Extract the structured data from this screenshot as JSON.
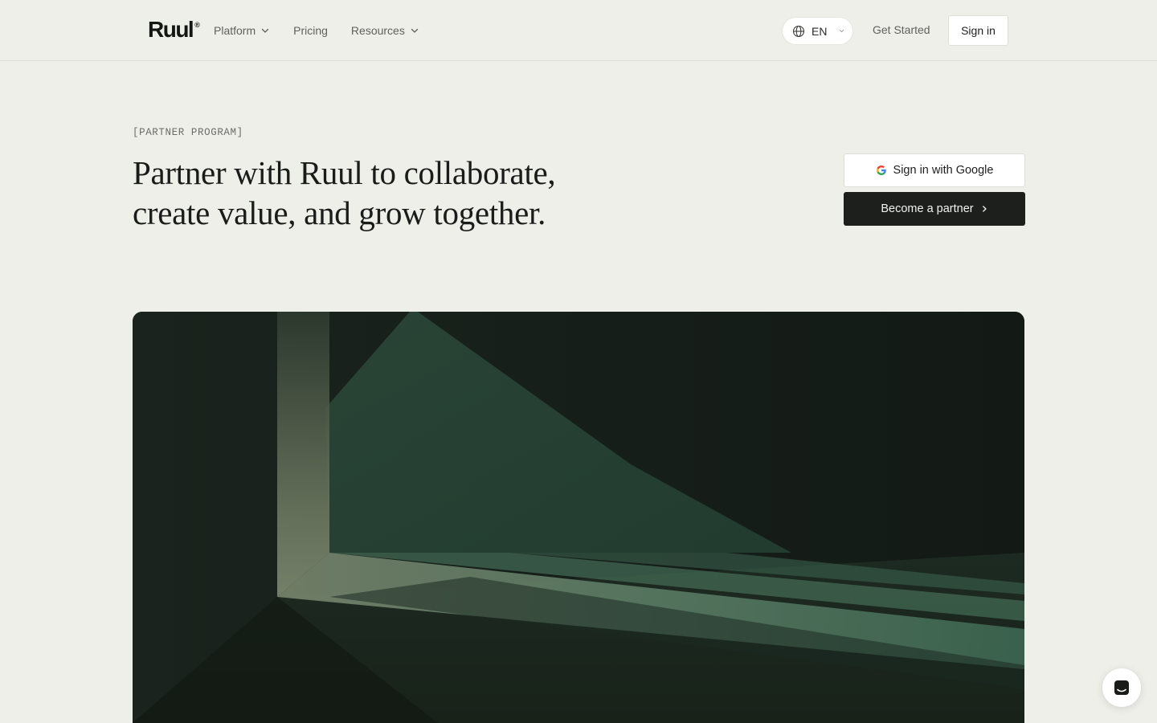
{
  "brand": {
    "name": "Ruul",
    "registered_mark": "®"
  },
  "nav": {
    "items": [
      {
        "label": "Platform",
        "has_dropdown": true
      },
      {
        "label": "Pricing",
        "has_dropdown": false
      },
      {
        "label": "Resources",
        "has_dropdown": true
      }
    ]
  },
  "header": {
    "language": "EN",
    "get_started": "Get Started",
    "sign_in": "Sign in"
  },
  "hero": {
    "eyebrow": "[PARTNER PROGRAM]",
    "headline_line1": "Partner with Ruul to collaborate,",
    "headline_line2": "create value, and grow together.",
    "google_button": "Sign in with Google",
    "partner_button": "Become a partner"
  },
  "icons": {
    "language": "globe-icon",
    "dropdown": "chevron-down-icon",
    "google": "google-icon",
    "partner_arrow": "chevron-right-icon",
    "chat": "chat-icon"
  },
  "colors": {
    "background": "#efefea",
    "primary_button": "#1c1f1c",
    "image_dark": "#16201a",
    "image_light": "#4f7d63"
  }
}
